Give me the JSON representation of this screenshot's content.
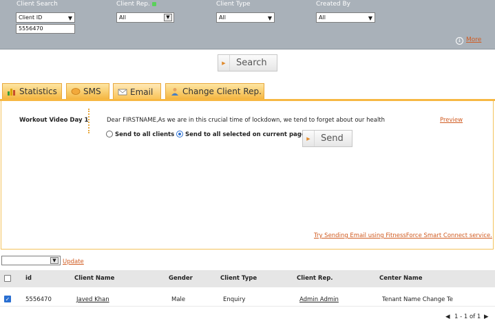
{
  "filters": {
    "client_search": {
      "label": "Client Search",
      "select_value": "Client ID",
      "input_value": "5556470"
    },
    "client_rep": {
      "label": "Client Rep.",
      "value": "All"
    },
    "client_type": {
      "label": "Client Type",
      "value": "All"
    },
    "created_by": {
      "label": "Created By",
      "value": "All"
    },
    "more_label": "More"
  },
  "search_button": "Search",
  "tabs": [
    {
      "label": "Statistics",
      "icon": "bar-chart-icon"
    },
    {
      "label": "SMS",
      "icon": "sms-icon"
    },
    {
      "label": "Email",
      "icon": "envelope-icon",
      "active": true
    },
    {
      "label": "Change Client Rep.",
      "icon": "person-icon"
    }
  ],
  "email": {
    "template_name": "Workout Video Day 1",
    "message_preview": "Dear FIRSTNAME,As we are in this crucial time of lockdown, we tend to forget about our health and bi",
    "preview_link": "Preview",
    "option_all": "Send to all clients",
    "option_selected": "Send to all selected on current page",
    "selected_option": "option_selected",
    "send_button": "Send",
    "smart_connect_link": "Try Sending Email using FitnessForce Smart Connect service."
  },
  "bulk": {
    "select_value": "",
    "update_link": "Update"
  },
  "table": {
    "headers": [
      "id",
      "Client Name",
      "Gender",
      "Client Type",
      "Client Rep.",
      "Center Name"
    ],
    "rows": [
      {
        "checked": true,
        "id": "5556470",
        "client_name": "Javed Khan",
        "gender": "Male",
        "client_type": "Enquiry",
        "client_rep": "Admin Admin",
        "center_name": "Tenant Name Change Te"
      }
    ]
  },
  "pagination": {
    "text": "1 - 1 of 1"
  },
  "colors": {
    "accent_orange": "#f5b742",
    "link": "#d05a1f",
    "filter_bg": "#a9b1b9"
  }
}
